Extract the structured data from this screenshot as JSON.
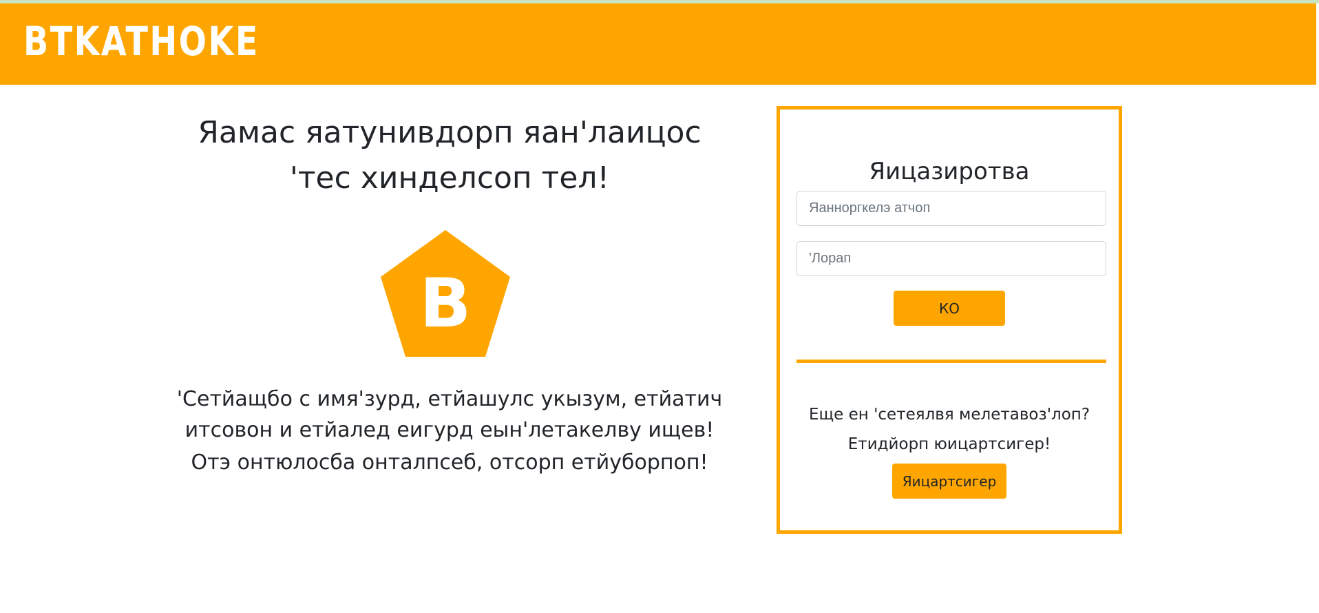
{
  "header": {
    "brand": "BTKATHOKE"
  },
  "main": {
    "headline_line1": "Яамас яатунивдорп яан'лаицос",
    "headline_line2": "'тес хинделсоп тел!",
    "logo_letter": "B",
    "description": "'Сетйащбо с имя'зурд, етйашулс укызум, етйатич итсовон и етйалед еигурд еын'летакелву ищев!",
    "tagline": "Отэ онтюлосба онталпсеб, отсорп етйуборпоп!"
  },
  "login": {
    "title": "Яицазиротва",
    "username_placeholder": "Яанноргкелэ атчоп",
    "password_placeholder": "'Лорап",
    "submit_label": "КО",
    "no_account_text": "Еще ен 'сетеялвя мелетавоз'лоп?",
    "register_prompt": "Етидйорп юицартсигер!",
    "register_label": "Яицартсигер"
  },
  "colors": {
    "accent": "#ffa500",
    "text": "#212529",
    "top_strip": "#c9e4c2"
  },
  "icons": {
    "logo": "pentagon-logo-icon"
  }
}
